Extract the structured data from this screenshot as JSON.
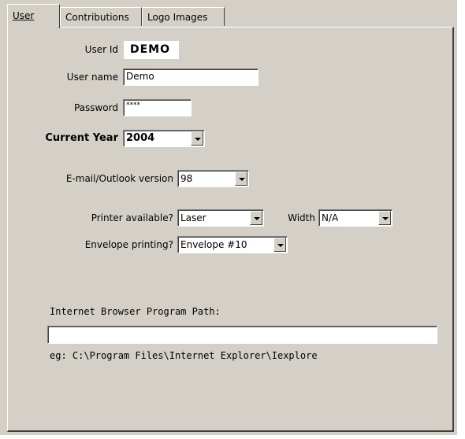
{
  "tabs": [
    {
      "label": "User",
      "active": true
    },
    {
      "label": "Contributions",
      "active": false
    },
    {
      "label": "Logo Images",
      "active": false
    }
  ],
  "user": {
    "user_id_label": "User Id",
    "user_id_value": "DEMO",
    "user_name_label": "User name",
    "user_name_value": "Demo",
    "password_label": "Password",
    "password_value": "****",
    "current_year_label": "Current Year",
    "current_year_value": "2004",
    "email_label": "E-mail/Outlook version",
    "email_value": "98",
    "printer_label": "Printer available?",
    "printer_value": "Laser",
    "width_label": "Width",
    "width_value": "N/A",
    "envelope_label": "Envelope printing?",
    "envelope_value": "Envelope #10",
    "browser_path_label": "Internet Browser Program Path:",
    "browser_path_value": "",
    "browser_path_example": "eg: C:\\Program Files\\Internet Explorer\\Iexplore"
  }
}
